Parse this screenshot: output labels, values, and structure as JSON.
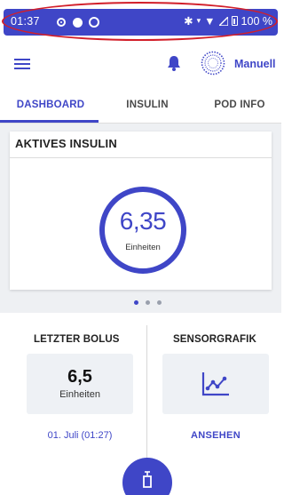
{
  "status_bar": {
    "time": "01:37",
    "battery": "100 %",
    "accent_color": "#3f46c7",
    "icons": [
      "record-icon",
      "circle-filled-icon",
      "sync-icon",
      "bluetooth-icon",
      "vibrate-icon",
      "wifi-icon",
      "signal-icon",
      "battery-icon"
    ]
  },
  "app_bar": {
    "mode_label": "Manuell",
    "icons": [
      "menu-icon",
      "bell-icon",
      "pod-status-icon"
    ]
  },
  "tabs": [
    {
      "label": "DASHBOARD",
      "active": true
    },
    {
      "label": "INSULIN",
      "active": false
    },
    {
      "label": "POD INFO",
      "active": false
    }
  ],
  "active_insulin": {
    "title": "AKTIVES INSULIN",
    "value": "6,35",
    "unit": "Einheiten"
  },
  "pager": {
    "count": 3,
    "current": 1
  },
  "last_bolus": {
    "title": "LETZTER BOLUS",
    "value": "6,5",
    "unit": "Einheiten",
    "date": "01. Juli (01:27)"
  },
  "sensor_graph": {
    "title": "SENSORGRAFIK",
    "link": "ANSEHEN",
    "icon": "chart-line-icon"
  },
  "fab": {
    "icon": "bolus-icon"
  }
}
